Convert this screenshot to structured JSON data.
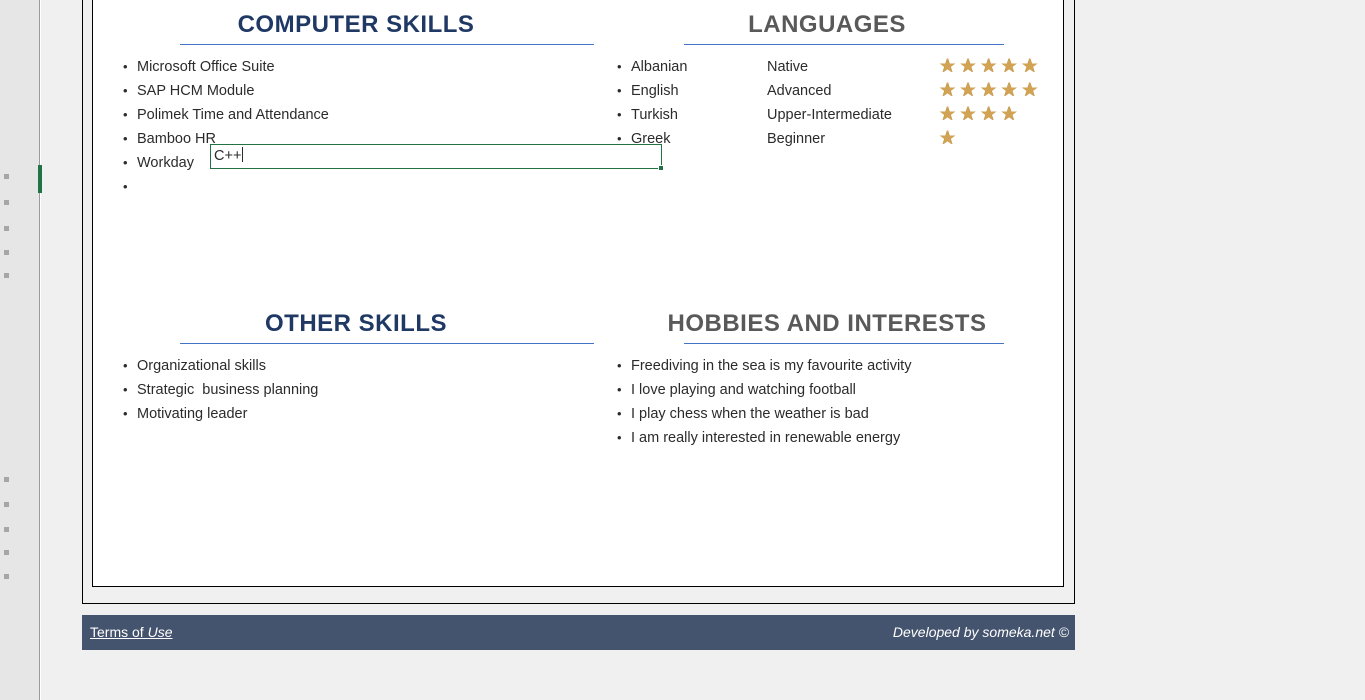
{
  "app": {
    "selection_accent_color": "#217346",
    "rail_marker_color": "#a6a6a6"
  },
  "active_cell": {
    "value": "C++",
    "is_editing": true
  },
  "sections": {
    "computer_skills": {
      "title": "COMPUTER SKILLS",
      "title_color": "#1f3864",
      "rule_color": "#4472c4",
      "items": [
        "Microsoft Office Suite",
        "SAP HCM Module",
        "Polimek Time and Attendance",
        "Bamboo HR",
        "Workday",
        "C++"
      ]
    },
    "languages": {
      "title": "LANGUAGES",
      "title_color": "#595959",
      "rule_color": "#4472c4",
      "rows": [
        {
          "name": "Albanian",
          "level": "Native",
          "rating": 5
        },
        {
          "name": "English",
          "level": "Advanced",
          "rating": 5
        },
        {
          "name": "Turkish",
          "level": "Upper-Intermediate",
          "rating": 4
        },
        {
          "name": "Greek",
          "level": "Beginner",
          "rating": 1
        }
      ],
      "star_color": "#d2a353",
      "max_rating": 5
    },
    "other_skills": {
      "title": "OTHER SKILLS",
      "title_color": "#1f3864",
      "rule_color": "#4472c4",
      "items": [
        "Organizational skills",
        "Strategic  business planning",
        "Motivating leader"
      ]
    },
    "hobbies": {
      "title": "HOBBIES AND INTERESTS",
      "title_color": "#595959",
      "rule_color": "#4472c4",
      "items": [
        "Freediving in the sea is my favourite activity",
        "I love playing and watching football",
        "I play chess when the weather is bad",
        "I am really interested in renewable energy"
      ]
    }
  },
  "footer": {
    "terms_prefix": "Terms of ",
    "terms_emphasis": "Use",
    "credit": "Developed by someka.net ©",
    "background_color": "#45546e"
  }
}
